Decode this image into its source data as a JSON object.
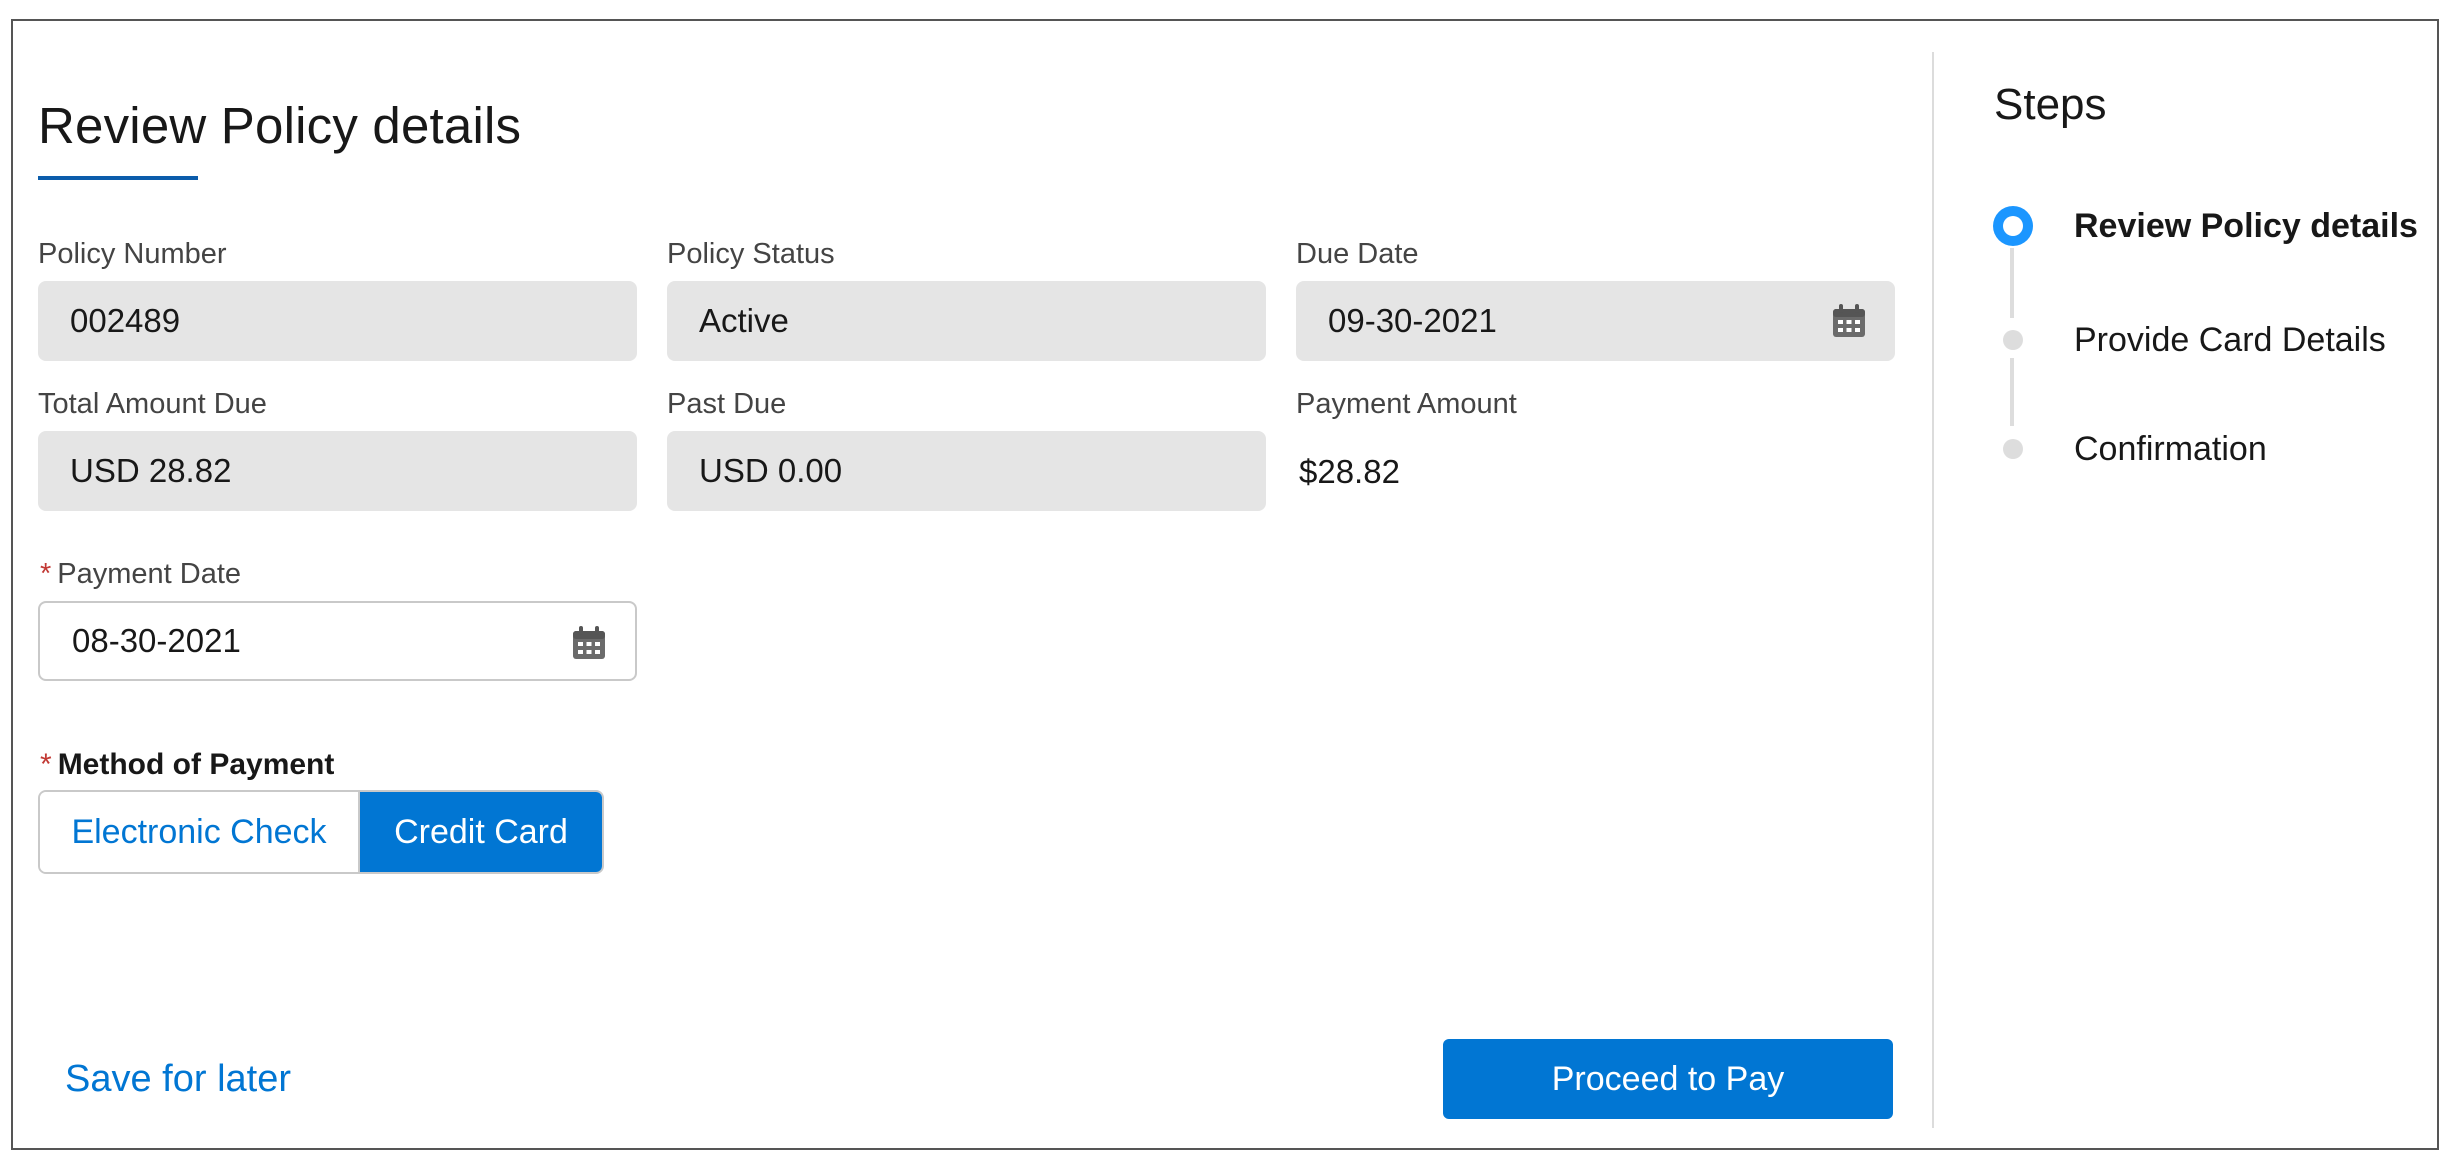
{
  "page": {
    "title": "Review Policy details"
  },
  "fields": {
    "policy_number": {
      "label": "Policy Number",
      "value": "002489"
    },
    "policy_status": {
      "label": "Policy Status",
      "value": "Active"
    },
    "due_date": {
      "label": "Due Date",
      "value": "09-30-2021"
    },
    "total_amount_due": {
      "label": "Total Amount Due",
      "value": "USD 28.82"
    },
    "past_due": {
      "label": "Past Due",
      "value": "USD 0.00"
    },
    "payment_amount": {
      "label": "Payment Amount",
      "value": "$28.82"
    },
    "payment_date": {
      "label": "Payment Date",
      "value": "08-30-2021",
      "required_marker": "*"
    }
  },
  "method_of_payment": {
    "label": "Method of Payment",
    "required_marker": "*",
    "options": [
      "Electronic Check",
      "Credit Card"
    ],
    "selected": "Credit Card"
  },
  "actions": {
    "save_for_later": "Save for later",
    "proceed_to_pay": "Proceed to Pay"
  },
  "steps": {
    "title": "Steps",
    "items": [
      {
        "label": "Review Policy details",
        "state": "active"
      },
      {
        "label": "Provide Card Details",
        "state": "pending"
      },
      {
        "label": "Confirmation",
        "state": "pending"
      }
    ]
  },
  "icons": {
    "date_picker": "calendar-icon"
  },
  "colors": {
    "accent": "#0176d3",
    "step_active": "#1b96ff",
    "title_underline": "#0b5cab",
    "required": "#c23934"
  }
}
